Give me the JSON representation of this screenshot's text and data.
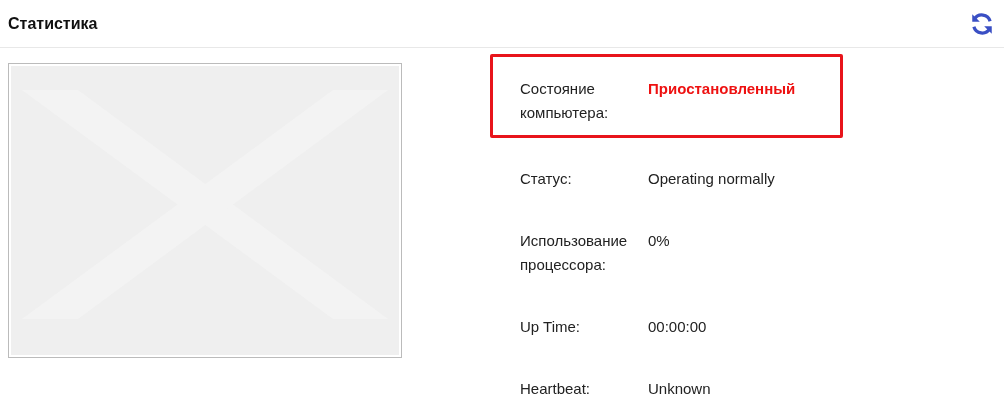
{
  "header": {
    "title": "Статистика"
  },
  "rows": [
    {
      "label": "Состояние компьютера:",
      "value": "Приостановленный",
      "kind": "alert",
      "highlighted": true
    },
    {
      "label": "Статус:",
      "value": "Operating normally",
      "kind": "plain",
      "highlighted": false
    },
    {
      "label": "Использование процессора:",
      "value": "0%",
      "kind": "plain",
      "highlighted": false
    },
    {
      "label": "Up Time:",
      "value": "00:00:00",
      "kind": "plain",
      "highlighted": false
    },
    {
      "label": "Heartbeat:",
      "value": "Unknown",
      "kind": "plain",
      "highlighted": false
    }
  ]
}
